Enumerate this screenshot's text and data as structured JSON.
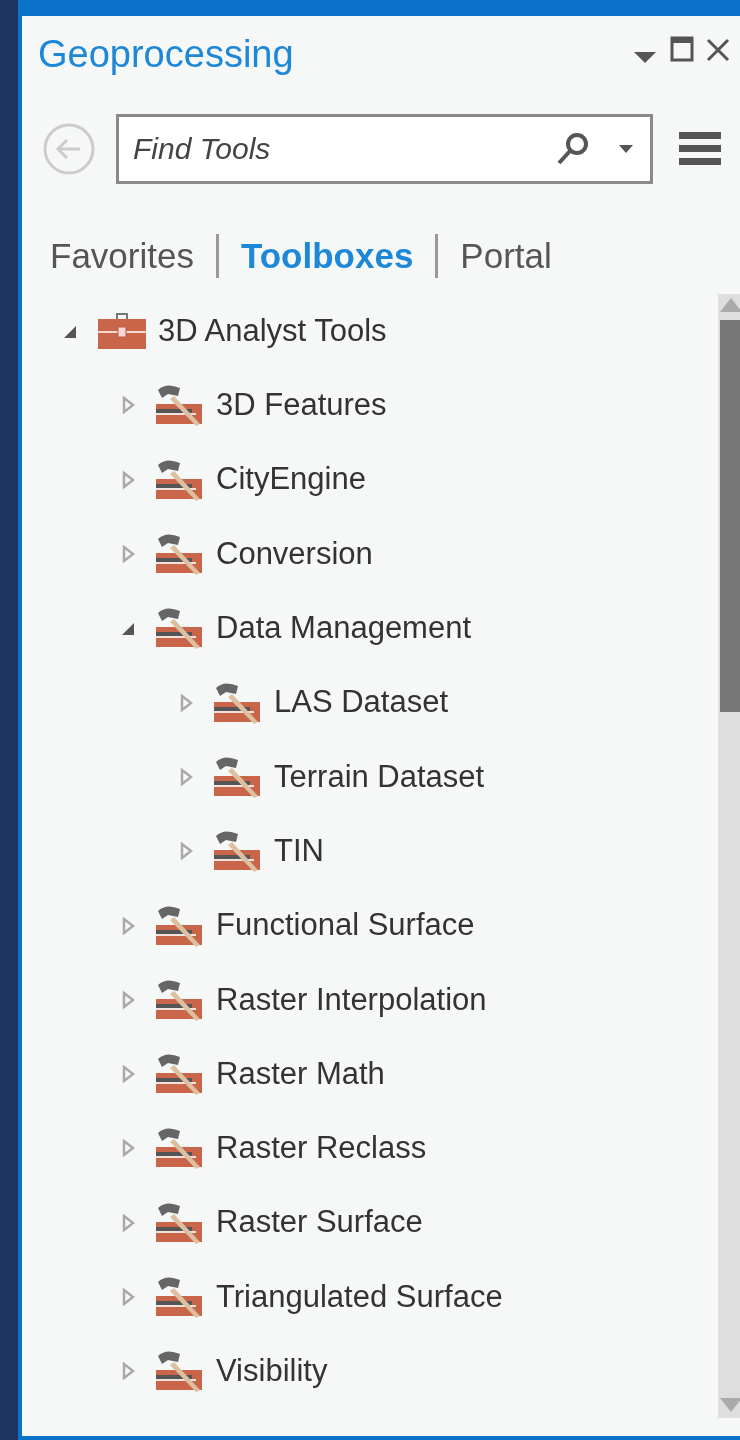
{
  "panel": {
    "title": "Geoprocessing"
  },
  "search": {
    "placeholder": "Find Tools"
  },
  "tabs": [
    {
      "label": "Favorites",
      "selected": false
    },
    {
      "label": "Toolboxes",
      "selected": true
    },
    {
      "label": "Portal",
      "selected": false
    }
  ],
  "tree": [
    {
      "label": "3D Analyst Tools",
      "kind": "toolbox",
      "expanded": true,
      "children": [
        {
          "label": "3D Features",
          "kind": "toolset",
          "expanded": false
        },
        {
          "label": "CityEngine",
          "kind": "toolset",
          "expanded": false
        },
        {
          "label": "Conversion",
          "kind": "toolset",
          "expanded": false
        },
        {
          "label": "Data Management",
          "kind": "toolset",
          "expanded": true,
          "children": [
            {
              "label": "LAS Dataset",
              "kind": "toolset",
              "expanded": false
            },
            {
              "label": "Terrain Dataset",
              "kind": "toolset",
              "expanded": false
            },
            {
              "label": "TIN",
              "kind": "toolset",
              "expanded": false
            }
          ]
        },
        {
          "label": "Functional Surface",
          "kind": "toolset",
          "expanded": false
        },
        {
          "label": "Raster Interpolation",
          "kind": "toolset",
          "expanded": false
        },
        {
          "label": "Raster Math",
          "kind": "toolset",
          "expanded": false
        },
        {
          "label": "Raster Reclass",
          "kind": "toolset",
          "expanded": false
        },
        {
          "label": "Raster Surface",
          "kind": "toolset",
          "expanded": false
        },
        {
          "label": "Triangulated Surface",
          "kind": "toolset",
          "expanded": false
        },
        {
          "label": "Visibility",
          "kind": "toolset",
          "expanded": false
        }
      ]
    }
  ]
}
